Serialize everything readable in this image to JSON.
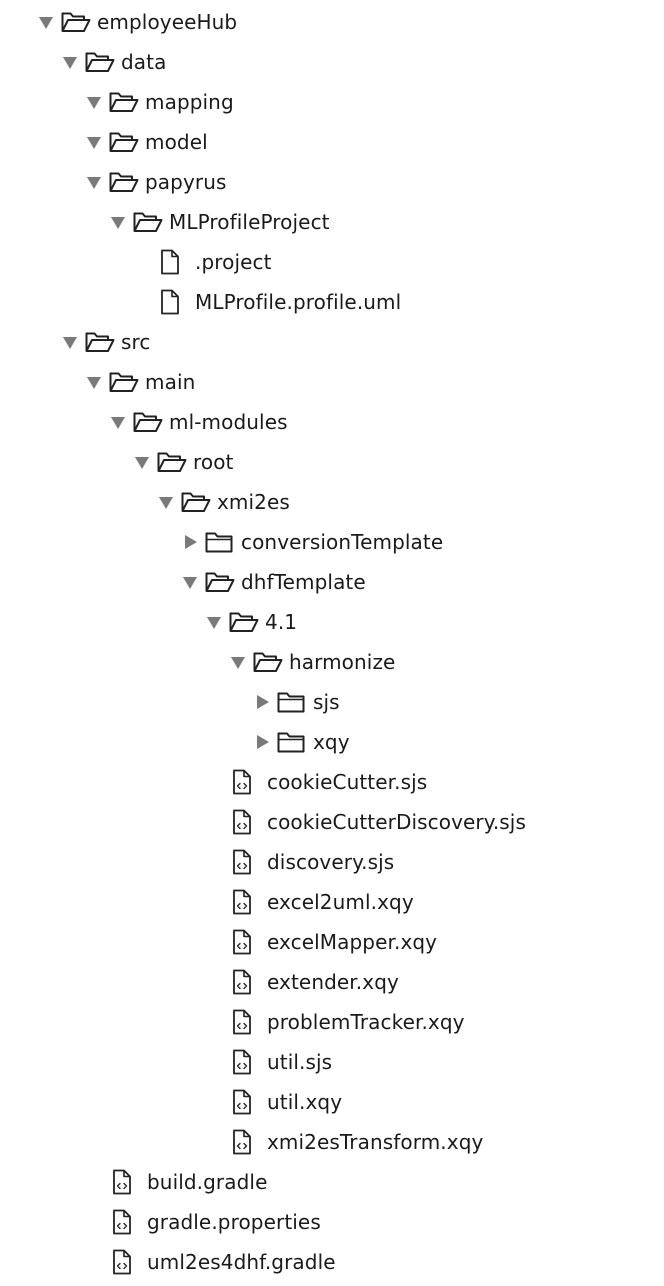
{
  "tree": [
    {
      "label": "employeeHub",
      "type": "folder",
      "state": "open",
      "depth": 0
    },
    {
      "label": "data",
      "type": "folder",
      "state": "open",
      "depth": 1
    },
    {
      "label": "mapping",
      "type": "folder",
      "state": "open",
      "depth": 2
    },
    {
      "label": "model",
      "type": "folder",
      "state": "open",
      "depth": 2
    },
    {
      "label": "papyrus",
      "type": "folder",
      "state": "open",
      "depth": 2
    },
    {
      "label": "MLProfileProject",
      "type": "folder",
      "state": "open",
      "depth": 3
    },
    {
      "label": ".project",
      "type": "file",
      "depth": 4
    },
    {
      "label": "MLProfile.profile.uml",
      "type": "file",
      "depth": 4
    },
    {
      "label": "src",
      "type": "folder",
      "state": "open",
      "depth": 1
    },
    {
      "label": "main",
      "type": "folder",
      "state": "open",
      "depth": 2
    },
    {
      "label": "ml-modules",
      "type": "folder",
      "state": "open",
      "depth": 3
    },
    {
      "label": "root",
      "type": "folder",
      "state": "open",
      "depth": 4
    },
    {
      "label": "xmi2es",
      "type": "folder",
      "state": "open",
      "depth": 5
    },
    {
      "label": "conversionTemplate",
      "type": "folder",
      "state": "closed",
      "depth": 6
    },
    {
      "label": "dhfTemplate",
      "type": "folder",
      "state": "open",
      "depth": 6
    },
    {
      "label": "4.1",
      "type": "folder",
      "state": "open",
      "depth": 7
    },
    {
      "label": "harmonize",
      "type": "folder",
      "state": "open",
      "depth": 8
    },
    {
      "label": "sjs",
      "type": "folder",
      "state": "closed",
      "depth": 9
    },
    {
      "label": "xqy",
      "type": "folder",
      "state": "closed",
      "depth": 9
    },
    {
      "label": "cookieCutter.sjs",
      "type": "code-file",
      "depth": 7
    },
    {
      "label": "cookieCutterDiscovery.sjs",
      "type": "code-file",
      "depth": 7
    },
    {
      "label": "discovery.sjs",
      "type": "code-file",
      "depth": 7
    },
    {
      "label": "excel2uml.xqy",
      "type": "code-file",
      "depth": 7
    },
    {
      "label": "excelMapper.xqy",
      "type": "code-file",
      "depth": 7
    },
    {
      "label": "extender.xqy",
      "type": "code-file",
      "depth": 7
    },
    {
      "label": "problemTracker.xqy",
      "type": "code-file",
      "depth": 7
    },
    {
      "label": "util.sjs",
      "type": "code-file",
      "depth": 7
    },
    {
      "label": "util.xqy",
      "type": "code-file",
      "depth": 7
    },
    {
      "label": "xmi2esTransform.xqy",
      "type": "code-file",
      "depth": 7
    },
    {
      "label": "build.gradle",
      "type": "code-file",
      "depth": 2
    },
    {
      "label": "gradle.properties",
      "type": "code-file",
      "depth": 2
    },
    {
      "label": "uml2es4dhf.gradle",
      "type": "code-file",
      "depth": 2
    }
  ],
  "colors": {
    "text": "#1a1a1a",
    "arrow": "#7a7a7a",
    "icon_stroke": "#222222",
    "background": "#ffffff"
  }
}
